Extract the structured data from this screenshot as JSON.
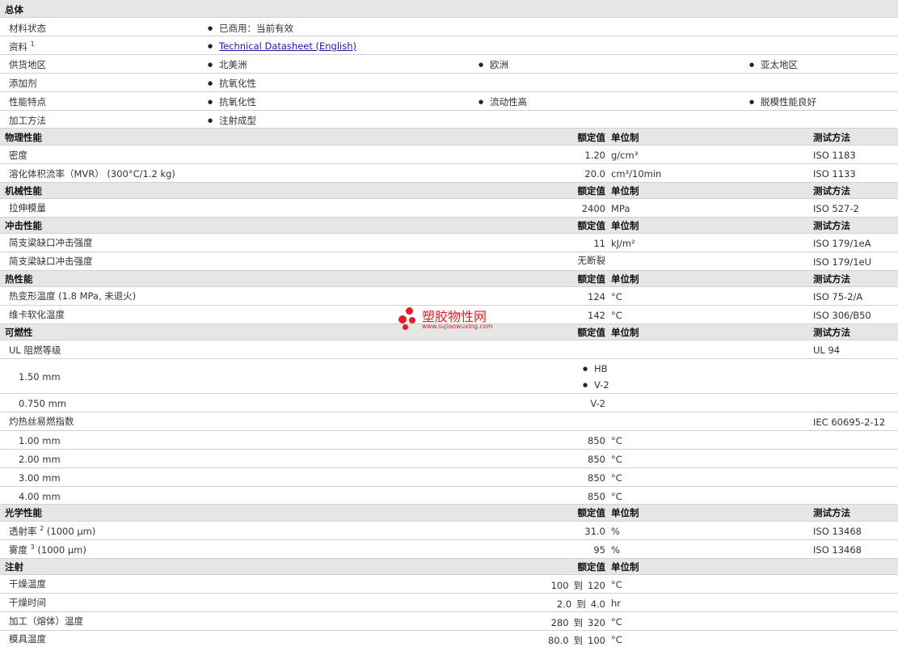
{
  "general": {
    "title": "总体",
    "status_label": "材料状态",
    "status_value": "已商用：当前有效",
    "docs_label": "资料",
    "docs_sup": "1",
    "docs_link": "Technical Datasheet (English)",
    "supply_label": "供货地区",
    "supply": [
      "北美洲",
      "欧洲",
      "亚太地区"
    ],
    "additive_label": "添加剂",
    "additive": "抗氧化性",
    "features_label": "性能特点",
    "features": [
      "抗氧化性",
      "流动性高",
      "脱模性能良好"
    ],
    "processing_label": "加工方法",
    "processing": "注射成型"
  },
  "col": {
    "value": "额定值",
    "unit": "单位制",
    "method": "测试方法"
  },
  "physical": {
    "title": "物理性能",
    "rows": [
      {
        "label": "密度",
        "value": "1.20",
        "unit": "g/cm³",
        "method": "ISO 1183"
      },
      {
        "label": "溶化体积流率（MVR） (300°C/1.2 kg)",
        "value": "20.0",
        "unit": "cm³/10min",
        "method": "ISO 1133"
      }
    ]
  },
  "mechanical": {
    "title": "机械性能",
    "rows": [
      {
        "label": "拉伸模量",
        "value": "2400",
        "unit": "MPa",
        "method": "ISO 527-2"
      }
    ]
  },
  "impact": {
    "title": "冲击性能",
    "rows": [
      {
        "label": "简支梁缺口冲击强度",
        "value": "11",
        "unit": "kJ/m²",
        "method": "ISO 179/1eA"
      },
      {
        "label": "简支梁缺口冲击强度",
        "value": "无断裂",
        "unit": "",
        "method": "ISO 179/1eU"
      }
    ]
  },
  "thermal": {
    "title": "热性能",
    "rows": [
      {
        "label": "热变形温度 (1.8 MPa, 未退火)",
        "value": "124",
        "unit": "°C",
        "method": "ISO 75-2/A"
      },
      {
        "label": "维卡软化温度",
        "value": "142",
        "unit": "°C",
        "method": "ISO 306/B50"
      }
    ]
  },
  "flammability": {
    "title": "可燃性",
    "ul_label": "UL 阻燃等级",
    "ul_method": "UL 94",
    "ul_150_label": "1.50 mm",
    "ul_150_values": [
      "HB",
      "V-2"
    ],
    "ul_075_label": "0.750 mm",
    "ul_075_value": "V-2",
    "gwfi_label": "灼热丝易燃指数",
    "gwfi_method": "IEC 60695-2-12",
    "gwfi_rows": [
      {
        "label": "1.00 mm",
        "value": "850",
        "unit": "°C"
      },
      {
        "label": "2.00 mm",
        "value": "850",
        "unit": "°C"
      },
      {
        "label": "3.00 mm",
        "value": "850",
        "unit": "°C"
      },
      {
        "label": "4.00 mm",
        "value": "850",
        "unit": "°C"
      }
    ]
  },
  "optical": {
    "title": "光学性能",
    "rows": [
      {
        "label": "透射率",
        "sup": "2",
        "suffix": "(1000 µm)",
        "value": "31.0",
        "unit": "%",
        "method": "ISO 13468"
      },
      {
        "label": "雾度",
        "sup": "3",
        "suffix": "(1000 µm)",
        "value": "95",
        "unit": "%",
        "method": "ISO 13468"
      }
    ]
  },
  "injection": {
    "title": "注射",
    "to": "到",
    "rows": [
      {
        "label": "干燥温度",
        "from": "100",
        "upto": "120",
        "unit": "°C"
      },
      {
        "label": "干燥时间",
        "from": "2.0",
        "upto": "4.0",
        "unit": "hr"
      },
      {
        "label": "加工（熔体）温度",
        "from": "280",
        "upto": "320",
        "unit": "°C"
      },
      {
        "label": "模具温度",
        "from": "80.0",
        "upto": "100",
        "unit": "°C"
      }
    ]
  },
  "watermark": {
    "name": "塑胶物性网",
    "url": "www.sujiaowuxing.com",
    "color": "#e21f26"
  }
}
